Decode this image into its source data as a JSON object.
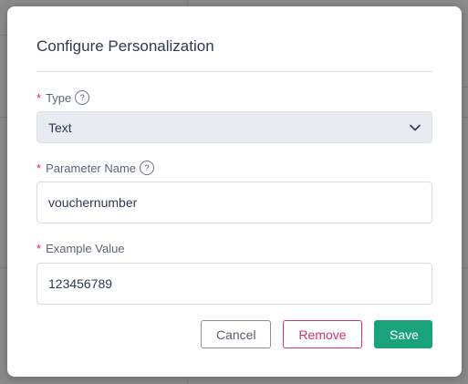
{
  "dialog": {
    "title": "Configure Personalization"
  },
  "fields": {
    "type": {
      "required_mark": "*",
      "label": "Type",
      "help": "?",
      "selected_value": "Text"
    },
    "parameter_name": {
      "required_mark": "*",
      "label": "Parameter Name",
      "help": "?",
      "value": "vouchernumber"
    },
    "example_value": {
      "required_mark": "*",
      "label": "Example Value",
      "value": "123456789"
    }
  },
  "footer": {
    "cancel_label": "Cancel",
    "remove_label": "Remove",
    "save_label": "Save"
  },
  "colors": {
    "accent_save": "#1aa37a",
    "remove": "#d4336a",
    "required": "#e0245e",
    "title": "#2b3a55"
  }
}
